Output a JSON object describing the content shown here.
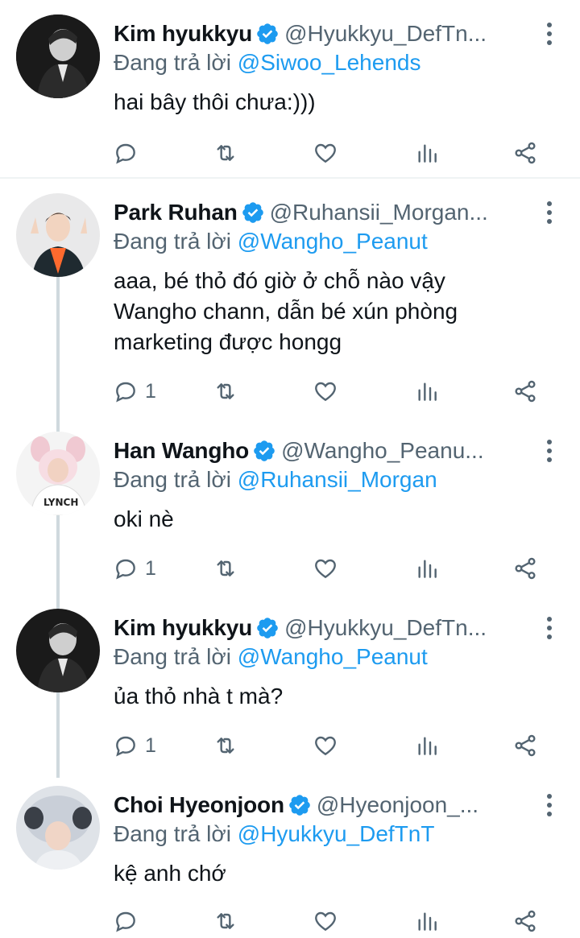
{
  "replying_label": "Đang trả lời",
  "tweets": [
    {
      "name": "Kim hyukkyu",
      "handle": "@Hyukkyu_DefTn...",
      "reply_to": "@Siwoo_Lehends",
      "lines": [
        "hai bây thôi chưa:)))"
      ],
      "reply_count": ""
    },
    {
      "name": "Park Ruhan",
      "handle": "@Ruhansii_Morgan...",
      "reply_to": "@Wangho_Peanut",
      "lines": [
        "aaa, bé thỏ đó giờ ở chỗ nào vậy",
        "Wangho chann, dẫn bé xún phòng",
        "marketing được hongg"
      ],
      "reply_count": "1"
    },
    {
      "name": "Han Wangho",
      "handle": "@Wangho_Peanu...",
      "reply_to": "@Ruhansii_Morgan",
      "lines": [
        "oki nè"
      ],
      "reply_count": "1"
    },
    {
      "name": "Kim hyukkyu",
      "handle": "@Hyukkyu_DefTn...",
      "reply_to": "@Wangho_Peanut",
      "lines": [
        "ủa thỏ nhà t mà?"
      ],
      "reply_count": "1"
    },
    {
      "name": "Choi Hyeonjoon",
      "handle": "@Hyeonjoon_...",
      "reply_to": "@Hyukkyu_DefTnT",
      "lines": [
        "kệ anh chớ"
      ],
      "reply_count": ""
    }
  ],
  "colors": {
    "accent": "#1d9bf0",
    "muted": "#536471",
    "text": "#0f1419"
  },
  "icons": [
    "verified-badge-icon",
    "more-icon",
    "reply-icon",
    "retweet-icon",
    "like-icon",
    "views-icon",
    "share-icon"
  ]
}
